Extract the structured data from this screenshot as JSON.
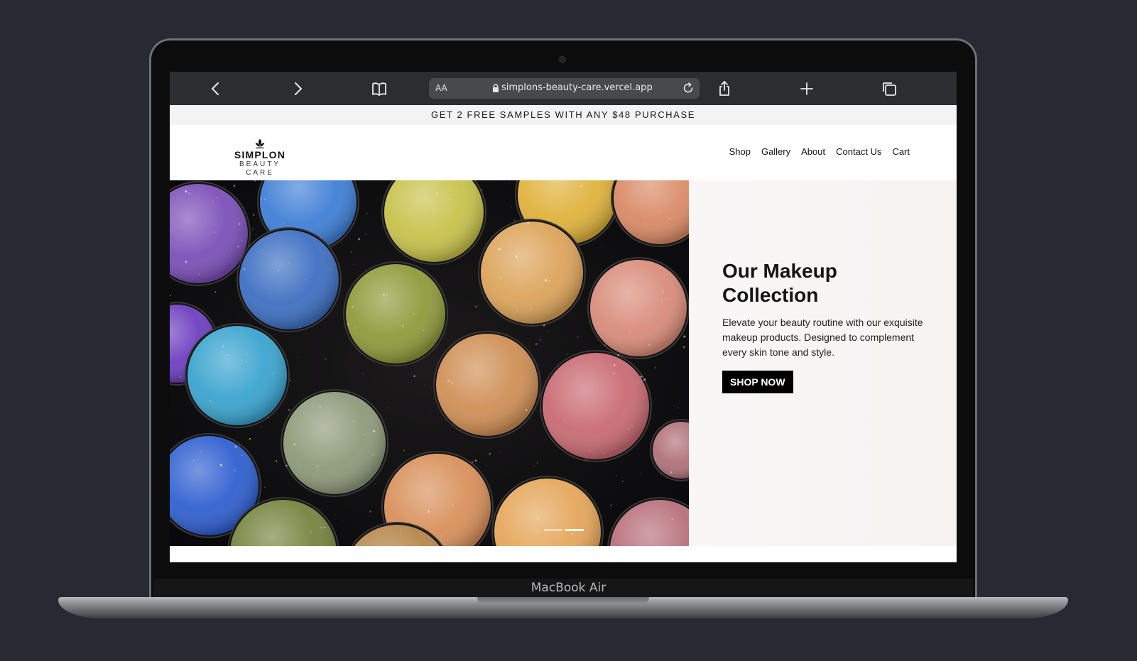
{
  "device": {
    "label": "MacBook Air"
  },
  "browser": {
    "aa_label": "AA",
    "url": "simplons-beauty-care.vercel.app"
  },
  "promo": {
    "text": "GET 2 FREE SAMPLES WITH ANY $48 PURCHASE"
  },
  "logo": {
    "name": "SIMPLON",
    "subtitle": "BEAUTY CARE"
  },
  "nav": {
    "items": [
      "Shop",
      "Gallery",
      "About",
      "Contact Us",
      "Cart"
    ]
  },
  "hero": {
    "title_line1": "Our Makeup",
    "title_line2": "Collection",
    "text": "Elevate your beauty routine with our exquisite makeup products. Designed to complement every skin tone and style.",
    "button": "SHOP NOW",
    "slider": {
      "count": 2,
      "active": 2
    }
  }
}
